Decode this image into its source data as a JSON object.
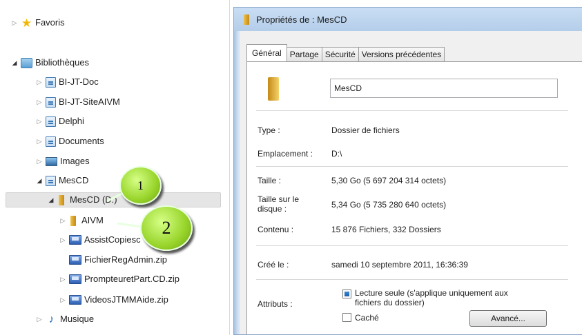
{
  "nav": {
    "favorites": "Favoris",
    "libraries": "Bibliothèques",
    "items": [
      "BI-JT-Doc",
      "BI-JT-SiteAIVM",
      "Delphi",
      "Documents",
      "Images",
      "MesCD"
    ],
    "drive": "MesCD (D:)",
    "children": [
      "AIVM",
      "AssistCopiesc",
      "FichierRegAdmin.zip",
      "PrompteuretPart.CD.zip",
      "VideosJTMMAide.zip"
    ],
    "music": "Musique"
  },
  "callouts": [
    "1",
    "2"
  ],
  "dialog": {
    "title": "Propriétés de : MesCD",
    "tabs": [
      "Général",
      "Partage",
      "Sécurité",
      "Versions précédentes"
    ],
    "name_value": "MesCD",
    "type_label": "Type :",
    "type_value": "Dossier de fichiers",
    "location_label": "Emplacement :",
    "location_value": "D:\\",
    "size_label": "Taille :",
    "size_value": "5,30 Go (5 697 204 314 octets)",
    "disk_size_label_1": "Taille sur le",
    "disk_size_label_2": "disque :",
    "disk_size_value": "5,34 Go (5 735 280 640 octets)",
    "contents_label": "Contenu :",
    "contents_value": "15 876 Fichiers, 332 Dossiers",
    "created_label": "Créé le :",
    "created_value": "samedi 10 septembre 2011, 16:36:39",
    "attributes_label": "Attributs :",
    "readonly_label_1": "Lecture seule (s'applique uniquement aux",
    "readonly_label_2": "fichiers du dossier)",
    "hidden_label": "Caché",
    "advanced_button": "Avancé..."
  }
}
